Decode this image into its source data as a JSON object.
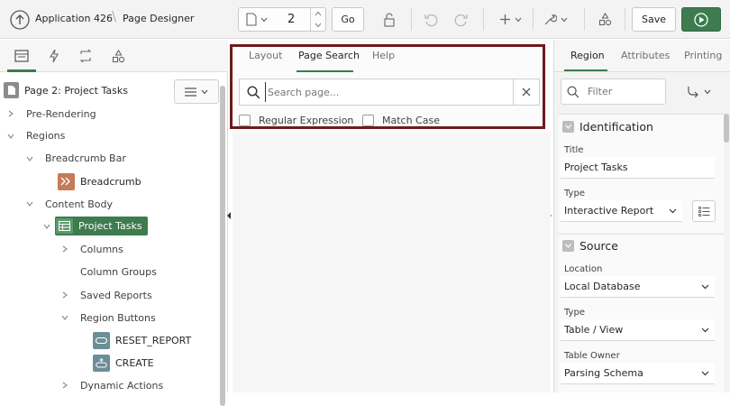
{
  "header": {
    "app_label": "Application 426",
    "page_title": "Page Designer",
    "page_number": "2",
    "go_label": "Go",
    "save_label": "Save"
  },
  "left_panel": {
    "page_node": "Page 2: Project Tasks",
    "tree": {
      "pre_rendering": "Pre-Rendering",
      "regions": "Regions",
      "breadcrumb_bar": "Breadcrumb Bar",
      "breadcrumb": "Breadcrumb",
      "content_body": "Content Body",
      "project_tasks": "Project Tasks",
      "columns": "Columns",
      "column_groups": "Column Groups",
      "saved_reports": "Saved Reports",
      "region_buttons": "Region Buttons",
      "reset_report": "RESET_REPORT",
      "create": "CREATE",
      "dynamic_actions": "Dynamic Actions"
    }
  },
  "center_panel": {
    "tabs": [
      "Layout",
      "Page Search",
      "Help"
    ],
    "active_tab": "Page Search",
    "search_placeholder": "Search page...",
    "options": {
      "regex": "Regular Expression",
      "match_case": "Match Case"
    }
  },
  "right_panel": {
    "tabs": [
      "Region",
      "Attributes",
      "Printing"
    ],
    "active_tab": "Region",
    "filter_placeholder": "Filter",
    "identification": {
      "heading": "Identification",
      "title_label": "Title",
      "title_value": "Project Tasks",
      "type_label": "Type",
      "type_value": "Interactive Report"
    },
    "source": {
      "heading": "Source",
      "location_label": "Location",
      "location_value": "Local Database",
      "type_label": "Type",
      "type_value": "Table / View",
      "owner_label": "Table Owner",
      "owner_value": "Parsing Schema"
    }
  },
  "colors": {
    "accent_green": "#3e7b4f",
    "highlight_border": "#6e1b1b",
    "breadcrumb_icon": "#c57a59",
    "button_icon": "#6c8e96"
  }
}
